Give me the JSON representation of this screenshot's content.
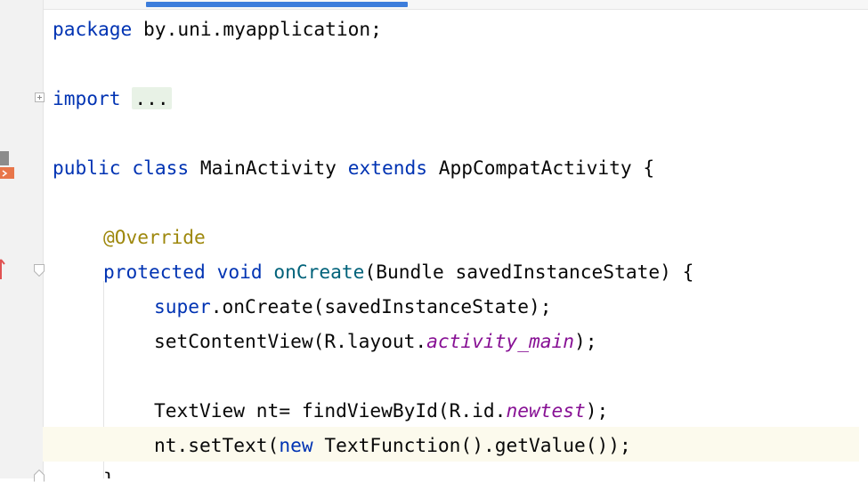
{
  "editor": {
    "line_package": {
      "kw": "package",
      "rest": " by.uni.myapplication;"
    },
    "line_import": {
      "kw": "import",
      "dots": "..."
    },
    "line_class": {
      "kw1": "public",
      "kw2": "class",
      "name": "MainActivity",
      "kw3": "extends",
      "rest": "AppCompatActivity {"
    },
    "line_annotation": "@Override",
    "line_method": {
      "kw1": "protected",
      "kw2": "void",
      "name": "onCreate",
      "rest": "(Bundle savedInstanceState) {"
    },
    "line_super": {
      "kw": "super",
      "rest": ".onCreate(savedInstanceState);"
    },
    "line_setcontent": {
      "pre": "setContentView(R.layout.",
      "field": "activity_main",
      "post": ");"
    },
    "line_textview": {
      "pre": "TextView nt= findViewById(R.id.",
      "field": "newtest",
      "post": ");"
    },
    "line_settext": {
      "pre": "nt.setText(",
      "kw": "new",
      "post": " TextFunction().getValue());"
    },
    "line_close": "}"
  },
  "colors": {
    "keyword": "#0033b3",
    "annotation": "#9e880d",
    "method_decl": "#00627a",
    "static_field": "#871094",
    "current_line": "#fcfaed",
    "tab_indicator": "#3d7ddb"
  }
}
